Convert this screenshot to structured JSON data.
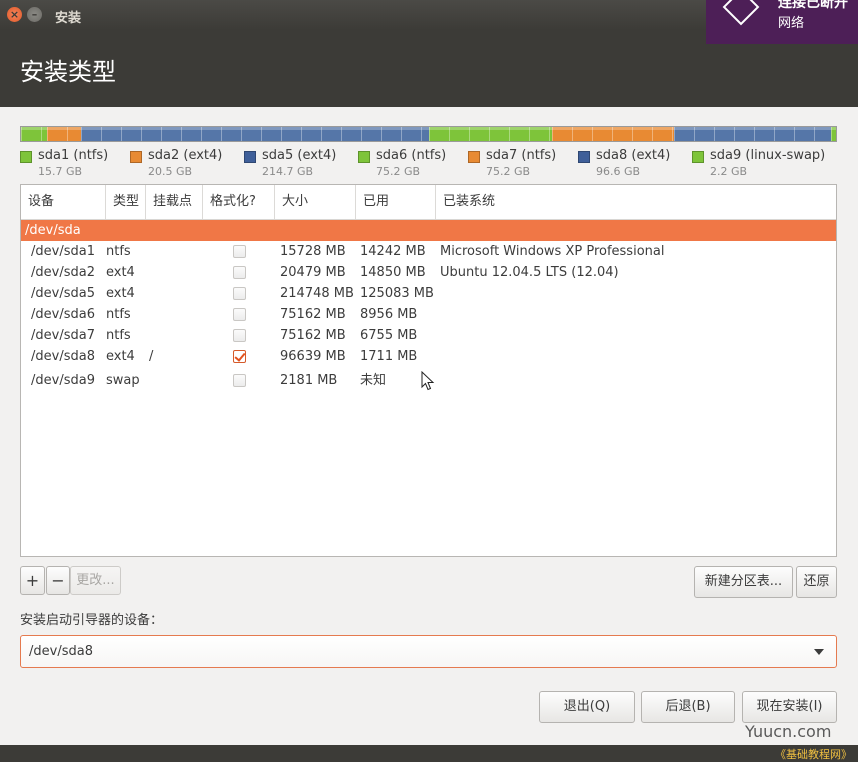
{
  "window": {
    "title": "安装"
  },
  "header": {
    "title": "安装类型"
  },
  "notification": {
    "title": "连接已断开",
    "body": "网络"
  },
  "partition_bar": {
    "segments": [
      {
        "name": "sda1",
        "fraction": 0.032,
        "color": "#7ec43a"
      },
      {
        "name": "sda2",
        "fraction": 0.042,
        "color": "#e88a33"
      },
      {
        "name": "sda5",
        "fraction": 0.427,
        "color": "#5576a8"
      },
      {
        "name": "sda6",
        "fraction": 0.15,
        "color": "#7ec43a"
      },
      {
        "name": "sda7",
        "fraction": 0.15,
        "color": "#e88a33"
      },
      {
        "name": "sda8",
        "fraction": 0.193,
        "color": "#5576a8"
      },
      {
        "name": "sda9",
        "fraction": 0.006,
        "color": "#7ec43a"
      }
    ]
  },
  "legend": [
    {
      "name": "sda1 (ntfs)",
      "size": "15.7 GB",
      "color": "#7ec43a"
    },
    {
      "name": "sda2 (ext4)",
      "size": "20.5 GB",
      "color": "#e88a33"
    },
    {
      "name": "sda5 (ext4)",
      "size": "214.7 GB",
      "color": "#3f5f99"
    },
    {
      "name": "sda6 (ntfs)",
      "size": "75.2 GB",
      "color": "#7ec43a"
    },
    {
      "name": "sda7 (ntfs)",
      "size": "75.2 GB",
      "color": "#e88a33"
    },
    {
      "name": "sda8 (ext4)",
      "size": "96.6 GB",
      "color": "#3f5f99"
    },
    {
      "name": "sda9 (linux-swap)",
      "size": "2.2 GB",
      "color": "#7ec43a"
    }
  ],
  "table": {
    "columns": [
      "设备",
      "类型",
      "挂载点",
      "格式化?",
      "大小",
      "已用",
      "已装系统"
    ],
    "disk_row": "/dev/sda",
    "rows": [
      {
        "device": "/dev/sda1",
        "type": "ntfs",
        "mount": "",
        "format": false,
        "size": "15728 MB",
        "used": "14242 MB",
        "system": "Microsoft Windows XP Professional"
      },
      {
        "device": "/dev/sda2",
        "type": "ext4",
        "mount": "",
        "format": false,
        "size": "20479 MB",
        "used": "14850 MB",
        "system": "Ubuntu 12.04.5 LTS (12.04)"
      },
      {
        "device": "/dev/sda5",
        "type": "ext4",
        "mount": "",
        "format": false,
        "size": "214748 MB",
        "used": "125083 MB",
        "system": ""
      },
      {
        "device": "/dev/sda6",
        "type": "ntfs",
        "mount": "",
        "format": false,
        "size": "75162 MB",
        "used": "8956 MB",
        "system": ""
      },
      {
        "device": "/dev/sda7",
        "type": "ntfs",
        "mount": "",
        "format": false,
        "size": "75162 MB",
        "used": "6755 MB",
        "system": ""
      },
      {
        "device": "/dev/sda8",
        "type": "ext4",
        "mount": "/",
        "format": true,
        "size": "96639 MB",
        "used": "1711 MB",
        "system": ""
      },
      {
        "device": "/dev/sda9",
        "type": "swap",
        "mount": "",
        "format": false,
        "size": "2181 MB",
        "used": "未知",
        "system": ""
      }
    ]
  },
  "toolbar": {
    "add_label": "+",
    "remove_label": "−",
    "change_label": "更改...",
    "new_table_label": "新建分区表...",
    "revert_label": "还原"
  },
  "boot_loader": {
    "label": "安装启动引导器的设备：",
    "value": "/dev/sda8"
  },
  "actions": {
    "quit_label": "退出(Q)",
    "back_label": "后退(B)",
    "install_label": "现在安装(I)"
  },
  "watermark": {
    "line1": "Yuucn.com",
    "line2": "《基础教程网》"
  }
}
